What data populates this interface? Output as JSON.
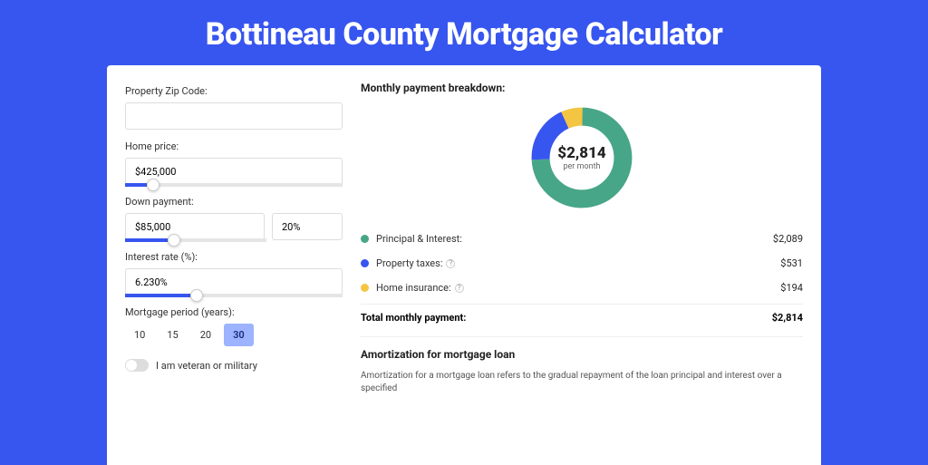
{
  "hero": {
    "title": "Bottineau County Mortgage Calculator"
  },
  "form": {
    "zip": {
      "label": "Property Zip Code:",
      "value": ""
    },
    "home_price": {
      "label": "Home price:",
      "value": "$425,000",
      "slider_pct": 10
    },
    "down_payment": {
      "label": "Down payment:",
      "value": "$85,000",
      "pct": "20%",
      "slider_pct": 20
    },
    "interest_rate": {
      "label": "Interest rate (%):",
      "value": "6.230%",
      "slider_pct": 30
    },
    "period": {
      "label": "Mortgage period (years):",
      "options": [
        "10",
        "15",
        "20",
        "30"
      ],
      "selected": "30"
    },
    "veteran": {
      "label": "I am veteran or military"
    }
  },
  "breakdown": {
    "heading": "Monthly payment breakdown:",
    "amount": "$2,814",
    "sub": "per month",
    "items": [
      {
        "label": "Principal & Interest:",
        "value": "$2,089",
        "color": "green"
      },
      {
        "label": "Property taxes:",
        "value": "$531",
        "color": "blue",
        "info": true
      },
      {
        "label": "Home insurance:",
        "value": "$194",
        "color": "yellow",
        "info": true
      }
    ],
    "total_label": "Total monthly payment:",
    "total_value": "$2,814"
  },
  "amort": {
    "heading": "Amortization for mortgage loan",
    "text": "Amortization for a mortgage loan refers to the gradual repayment of the loan principal and interest over a specified"
  },
  "chart_data": {
    "type": "pie",
    "title": "Monthly payment breakdown",
    "categories": [
      "Principal & Interest",
      "Property taxes",
      "Home insurance"
    ],
    "values": [
      2089,
      531,
      194
    ],
    "colors": [
      "#47a687",
      "#3755ef",
      "#f4c542"
    ],
    "center_label": "$2,814 per month"
  }
}
